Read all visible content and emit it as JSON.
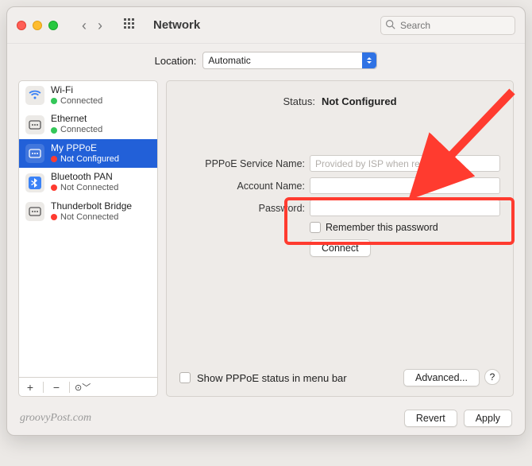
{
  "window": {
    "title": "Network"
  },
  "search": {
    "placeholder": "Search"
  },
  "location": {
    "label": "Location:",
    "value": "Automatic"
  },
  "services": [
    {
      "name": "Wi-Fi",
      "status": "Connected",
      "dot": "green",
      "icon": "wifi"
    },
    {
      "name": "Ethernet",
      "status": "Connected",
      "dot": "green",
      "icon": "ethernet"
    },
    {
      "name": "My PPPoE",
      "status": "Not Configured",
      "dot": "red",
      "icon": "ethernet",
      "selected": true
    },
    {
      "name": "Bluetooth PAN",
      "status": "Not Connected",
      "dot": "red",
      "icon": "bluetooth"
    },
    {
      "name": "Thunderbolt Bridge",
      "status": "Not Connected",
      "dot": "red",
      "icon": "ethernet"
    }
  ],
  "detail": {
    "status_label": "Status:",
    "status_value": "Not Configured",
    "fields": {
      "service_name_label": "PPPoE Service Name:",
      "service_name_placeholder": "Provided by ISP when required",
      "account_label": "Account Name:",
      "account_value": "",
      "password_label": "Password:",
      "password_value": ""
    },
    "remember_label": "Remember this password",
    "connect_label": "Connect",
    "show_status_label": "Show PPPoE status in menu bar",
    "advanced_label": "Advanced..."
  },
  "buttons": {
    "revert": "Revert",
    "apply": "Apply"
  },
  "brand": "groovyPost.com"
}
